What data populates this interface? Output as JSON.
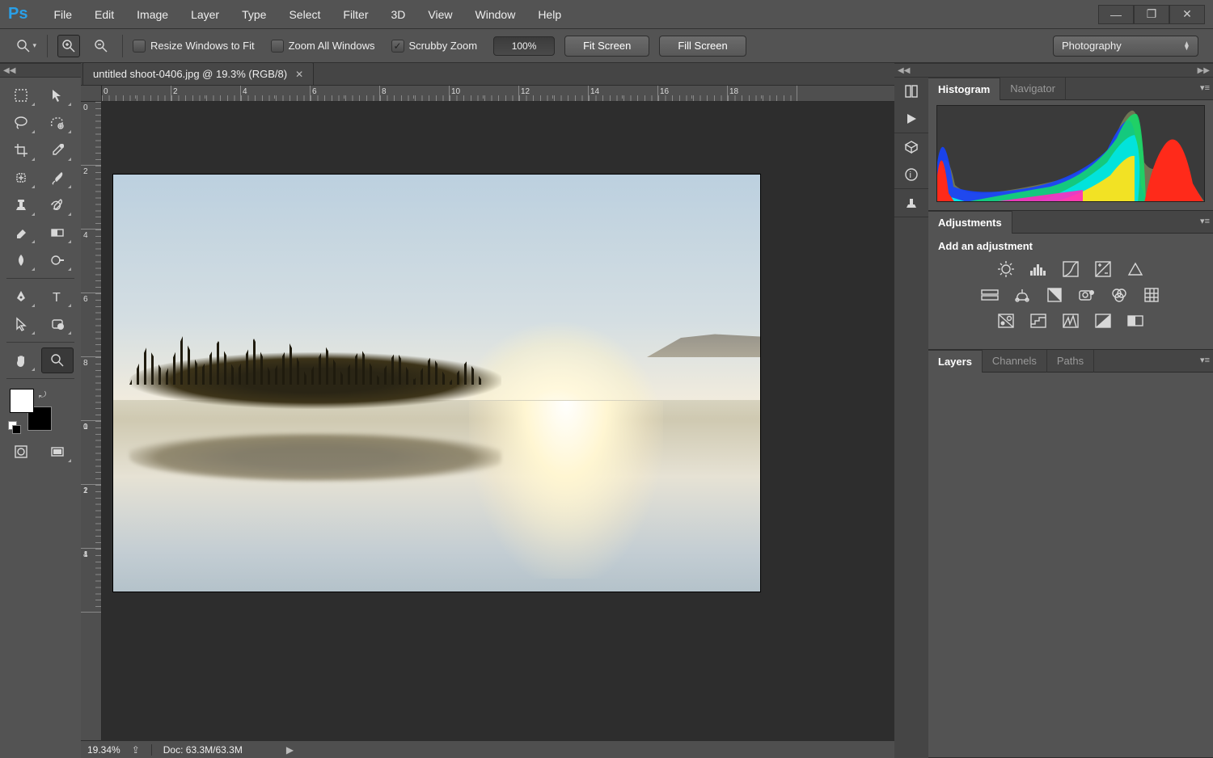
{
  "menubar": {
    "app_logo": "Ps",
    "items": [
      "File",
      "Edit",
      "Image",
      "Layer",
      "Type",
      "Select",
      "Filter",
      "3D",
      "View",
      "Window",
      "Help"
    ]
  },
  "optionsbar": {
    "resize_windows": {
      "label": "Resize Windows to Fit",
      "checked": false
    },
    "zoom_all": {
      "label": "Zoom All Windows",
      "checked": false
    },
    "scrubby": {
      "label": "Scrubby Zoom",
      "checked": true
    },
    "zoom_value": "100%",
    "fit_screen": "Fit Screen",
    "fill_screen": "Fill Screen",
    "workspace": "Photography"
  },
  "document": {
    "tab_title": "untitled shoot-0406.jpg @ 19.3% (RGB/8)",
    "ruler_h": [
      "0",
      "2",
      "4",
      "6",
      "8",
      "10",
      "12",
      "14",
      "16",
      "18"
    ],
    "ruler_v": [
      "0",
      "2",
      "4",
      "6",
      "8",
      "10",
      "12",
      "14"
    ],
    "status_zoom": "19.34%",
    "status_doc": "Doc: 63.3M/63.3M"
  },
  "panels": {
    "histogram": {
      "tabs": [
        "Histogram",
        "Navigator"
      ],
      "active": 0
    },
    "adjustments": {
      "tab": "Adjustments",
      "title": "Add an adjustment"
    },
    "layers": {
      "tabs": [
        "Layers",
        "Channels",
        "Paths"
      ],
      "active": 0
    }
  },
  "tools": [
    "marquee",
    "move",
    "lasso",
    "quick-select",
    "crop",
    "eyedropper",
    "spot-heal",
    "brush",
    "clone",
    "history-brush",
    "eraser",
    "gradient",
    "blur",
    "dodge",
    "pen",
    "type",
    "path-select",
    "shape",
    "hand",
    "zoom"
  ]
}
